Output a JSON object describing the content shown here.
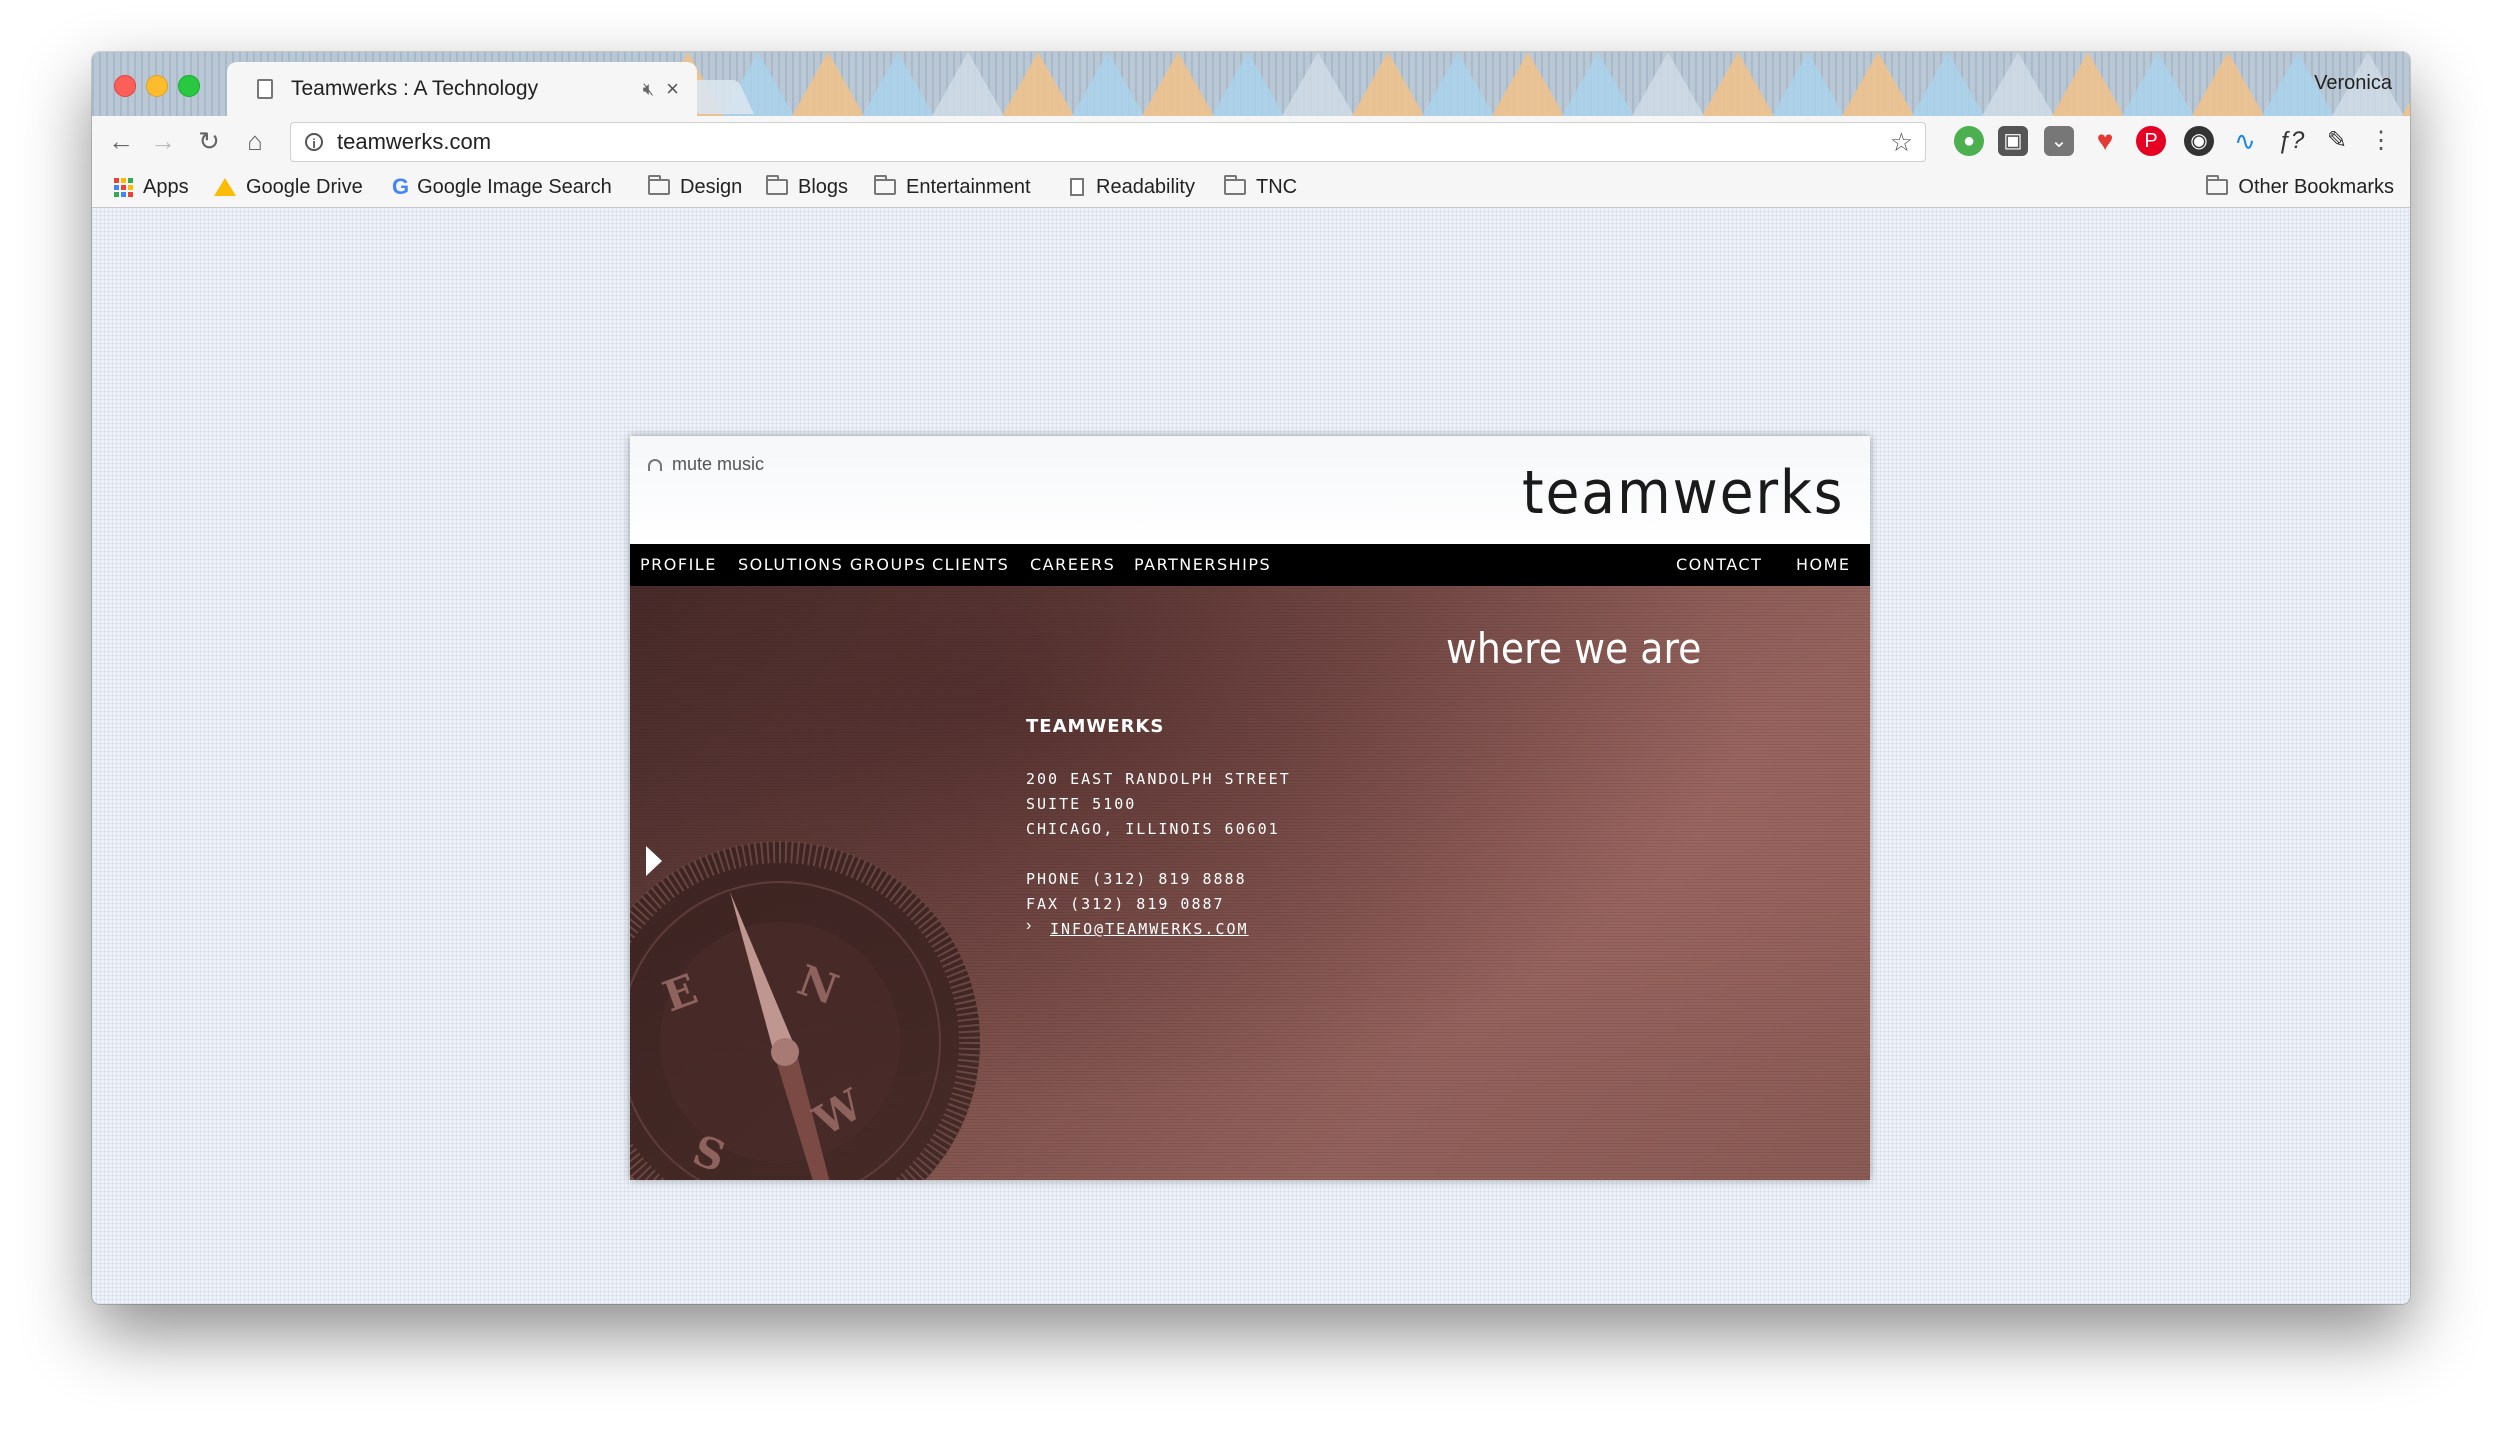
{
  "browser": {
    "tab_title": "Teamwerks : A Technology",
    "tab_mute_icon": "speaker-muted-icon",
    "tab_close": "×",
    "profile_name": "Veronica",
    "url": "teamwerks.com",
    "bookmarks": [
      {
        "label": "Apps",
        "icon": "apps-grid-icon"
      },
      {
        "label": "Google Drive",
        "icon": "google-drive-icon"
      },
      {
        "label": "Google Image Search",
        "icon": "google-icon"
      },
      {
        "label": "Design",
        "icon": "folder-icon"
      },
      {
        "label": "Blogs",
        "icon": "folder-icon"
      },
      {
        "label": "Entertainment",
        "icon": "folder-icon"
      },
      {
        "label": "Readability",
        "icon": "page-icon"
      },
      {
        "label": "TNC",
        "icon": "folder-icon"
      }
    ],
    "other_bookmarks": "Other Bookmarks"
  },
  "site": {
    "mute_label": "mute music",
    "logo": "teamwerks",
    "nav_left": [
      "PROFILE",
      "SOLUTIONS GROUPS",
      "CLIENTS",
      "CAREERS",
      "PARTNERSHIPS"
    ],
    "nav_right": [
      "CONTACT",
      "HOME"
    ],
    "heading": "where we are",
    "company": "TEAMWERKS",
    "address": [
      "200 EAST RANDOLPH STREET",
      "SUITE 5100",
      "CHICAGO, ILLINOIS 60601"
    ],
    "phone": "PHONE  (312) 819 8888",
    "fax": "FAX  (312) 819 0887",
    "email": "INFO@TEAMWERKS.COM",
    "colors": {
      "nav_bg": "#000000",
      "panel": "#8b5b55"
    }
  }
}
